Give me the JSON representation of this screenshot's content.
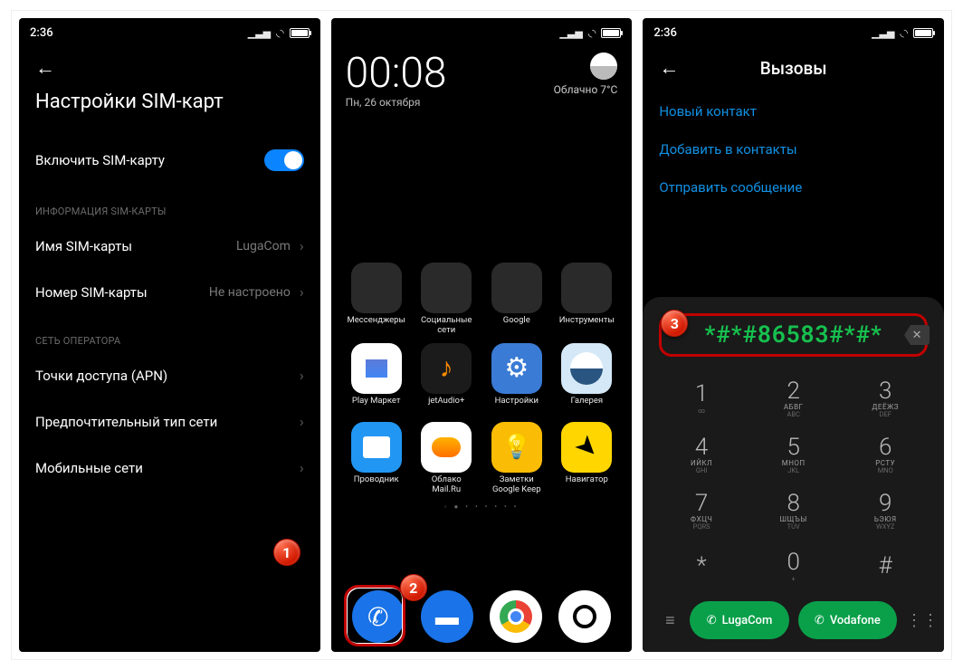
{
  "status": {
    "time": "2:36"
  },
  "screen1": {
    "title": "Настройки SIM-карт",
    "enable_sim": "Включить SIM-карту",
    "section_info": "ИНФОРМАЦИЯ SIM-КАРТЫ",
    "sim_name_label": "Имя SIM-карты",
    "sim_name_value": "LugaCom",
    "sim_number_label": "Номер SIM-карты",
    "sim_number_value": "Не настроено",
    "section_network": "СЕТЬ ОПЕРАТОРА",
    "apn": "Точки доступа (APN)",
    "net_type": "Предпочтительный тип сети",
    "mobile_net": "Мобильные сети",
    "badge": "1"
  },
  "screen2": {
    "clock": "00:08",
    "date": "Пн, 26 октября",
    "weather": "Облачно  7°С",
    "folders": [
      "Мессенджеры",
      "Социальные\nсети",
      "Google",
      "Инструменты"
    ],
    "apps_row2": [
      "Play Маркет",
      "jetAudio+",
      "Настройки",
      "Галерея"
    ],
    "apps_row3": [
      "Проводник",
      "Облако\nMail.Ru",
      "Заметки\nGoogle Keep",
      "Навигатор"
    ],
    "badge": "2"
  },
  "screen3": {
    "title": "Вызовы",
    "new_contact": "Новый контакт",
    "add_contact": "Добавить в контакты",
    "send_sms": "Отправить сообщение",
    "code": "*#*#86583#*#*",
    "badge": "3",
    "keys": [
      {
        "n": "1",
        "ru": "",
        "en": "∞"
      },
      {
        "n": "2",
        "ru": "АБВГ",
        "en": "ABC"
      },
      {
        "n": "3",
        "ru": "ДЕЁЖЗ",
        "en": "DEF"
      },
      {
        "n": "4",
        "ru": "ИЙКЛ",
        "en": "GHI"
      },
      {
        "n": "5",
        "ru": "МНОП",
        "en": "JKL"
      },
      {
        "n": "6",
        "ru": "РСТУ",
        "en": "MNO"
      },
      {
        "n": "7",
        "ru": "ФХЦЧ",
        "en": "PQRS"
      },
      {
        "n": "8",
        "ru": "ШЩЪЫ",
        "en": "TUV"
      },
      {
        "n": "9",
        "ru": "ЬЭЮЯ",
        "en": "WXYZ"
      },
      {
        "n": "*",
        "ru": "",
        "en": ""
      },
      {
        "n": "0",
        "ru": "",
        "en": "+"
      },
      {
        "n": "#",
        "ru": "",
        "en": ""
      }
    ],
    "sim1": "LugaCom",
    "sim2": "Vodafone"
  }
}
